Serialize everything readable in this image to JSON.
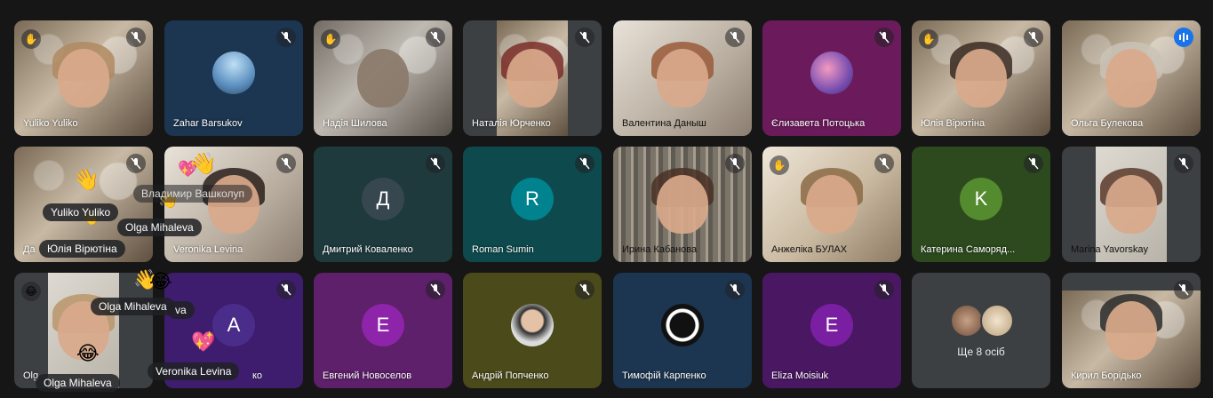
{
  "tiles": [
    {
      "name": "Yuliko Yuliko",
      "bg": "#5a4a3a"
    },
    {
      "name": "Zahar Barsukov",
      "bg": "#1c3550"
    },
    {
      "name": "Надія Шилова",
      "bg": "#5a4a3a"
    },
    {
      "name": "Наталія Юрченко",
      "bg": "#3c4043"
    },
    {
      "name": "Валентина Даныш",
      "bg": "#3c4043"
    },
    {
      "name": "Єлизавета Потоцька",
      "bg": "#6b1b5b"
    },
    {
      "name": "Юлія Вірютіна",
      "bg": "#5a4a3a"
    },
    {
      "name": "Ольга Булекова",
      "bg": "#3c4043"
    },
    {
      "name": "Да",
      "bg": "#5a4a3a"
    },
    {
      "name": "Veronika Levina",
      "bg": "#3c4043"
    },
    {
      "name": "Дмитрий Коваленко",
      "bg": "#1e3a3d",
      "letter": "Д",
      "letter_bg": "#37474f"
    },
    {
      "name": "Roman Sumin",
      "bg": "#0e4a4d",
      "letter": "R",
      "letter_bg": "#00838f"
    },
    {
      "name": "Ирина Кабанова",
      "bg": "#3c4043"
    },
    {
      "name": "Анжеліка БУЛАХ",
      "bg": "#3c4043"
    },
    {
      "name": "Катерина Саморяд...",
      "bg": "#2d4a1f",
      "letter": "K",
      "letter_bg": "#558b2f"
    },
    {
      "name": "Marina Yavorskay",
      "bg": "#3c4043"
    },
    {
      "name": "Olg",
      "bg": "#3c4043"
    },
    {
      "name": "ко",
      "bg": "#3e1d6e",
      "letter": "A",
      "letter_bg": "#4a2d8a"
    },
    {
      "name": "Евгений Новоселов",
      "bg": "#5e1f6b",
      "letter": "E",
      "letter_bg": "#8e24aa"
    },
    {
      "name": "Андрій Попченко",
      "bg": "#4a4a1a"
    },
    {
      "name": "Тимофій Карпенко",
      "bg": "#1c3550"
    },
    {
      "name": "Eliza Moisiuk",
      "bg": "#4a1763",
      "letter": "E",
      "letter_bg": "#7b1fa2"
    },
    {
      "name": "Ще 8 осіб",
      "bg": "#3c4043"
    },
    {
      "name": "Кирил Борідько",
      "bg": "#3c4043"
    }
  ],
  "reactions": {
    "r1": "Владимир Вашколуп",
    "r2": "Yuliko Yuliko",
    "r3": "Olga Mihaleva",
    "r4": "Юлія Вірютіна",
    "r5": "Olga Mihaleva",
    "r6": "va",
    "r7": "Veronika Levina",
    "r8": "Olga Mihaleva"
  },
  "colors": {
    "accent": "#8ab4f8",
    "speaking": "#1a73e8"
  }
}
